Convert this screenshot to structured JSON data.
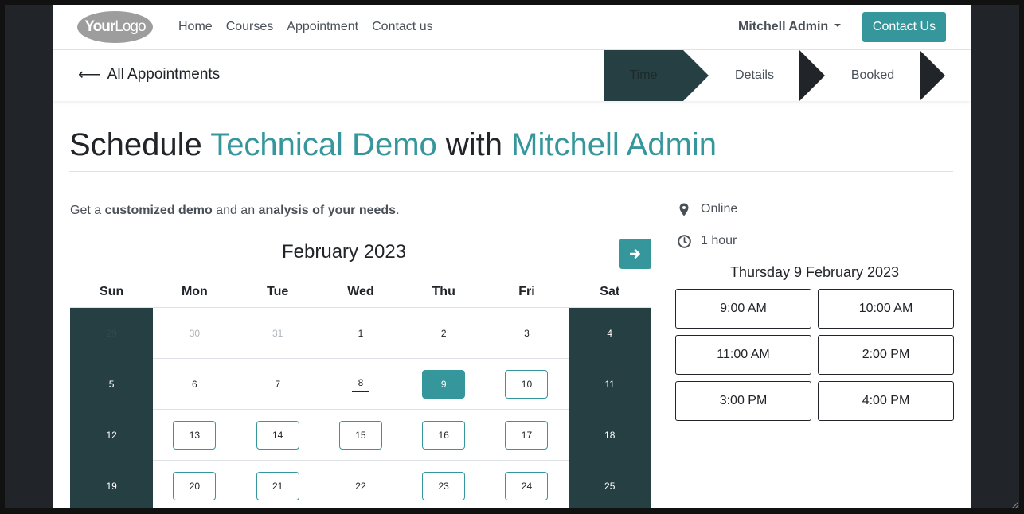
{
  "navbar": {
    "logo_bold": "Your",
    "logo_light": "Logo",
    "links": [
      "Home",
      "Courses",
      "Appointment",
      "Contact us"
    ],
    "user": "Mitchell Admin",
    "contact_button": "Contact Us"
  },
  "subbar": {
    "back_label": "All Appointments",
    "steps": [
      "Time",
      "Details",
      "Booked"
    ]
  },
  "title": {
    "prefix": "Schedule",
    "appointment": "Technical Demo",
    "middle": "with",
    "staff": "Mitchell Admin"
  },
  "description": {
    "p1": "Get a ",
    "b1": "customized demo",
    "p2": " and an ",
    "b2": "analysis of your needs",
    "p3": "."
  },
  "calendar": {
    "month": "February 2023",
    "weekdays": [
      "Sun",
      "Mon",
      "Tue",
      "Wed",
      "Thu",
      "Fri",
      "Sat"
    ],
    "rows": [
      [
        "29",
        "30",
        "31",
        "1",
        "2",
        "3",
        "4"
      ],
      [
        "5",
        "6",
        "7",
        "8",
        "9",
        "10",
        "11"
      ],
      [
        "12",
        "13",
        "14",
        "15",
        "16",
        "17",
        "18"
      ],
      [
        "19",
        "20",
        "21",
        "22",
        "23",
        "24",
        "25"
      ]
    ],
    "selected_day": "9",
    "today": "8",
    "available_days": [
      "9",
      "10",
      "13",
      "14",
      "15",
      "16",
      "17",
      "20",
      "21",
      "23",
      "24"
    ],
    "muted_days": [
      "29",
      "30",
      "31"
    ]
  },
  "details": {
    "location": "Online",
    "duration": "1 hour",
    "selected_date": "Thursday 9 February 2023",
    "slots": [
      "9:00 AM",
      "10:00 AM",
      "11:00 AM",
      "2:00 PM",
      "3:00 PM",
      "4:00 PM"
    ]
  },
  "colors": {
    "accent": "#35979c",
    "dark": "#263f42",
    "frame": "#212529"
  }
}
